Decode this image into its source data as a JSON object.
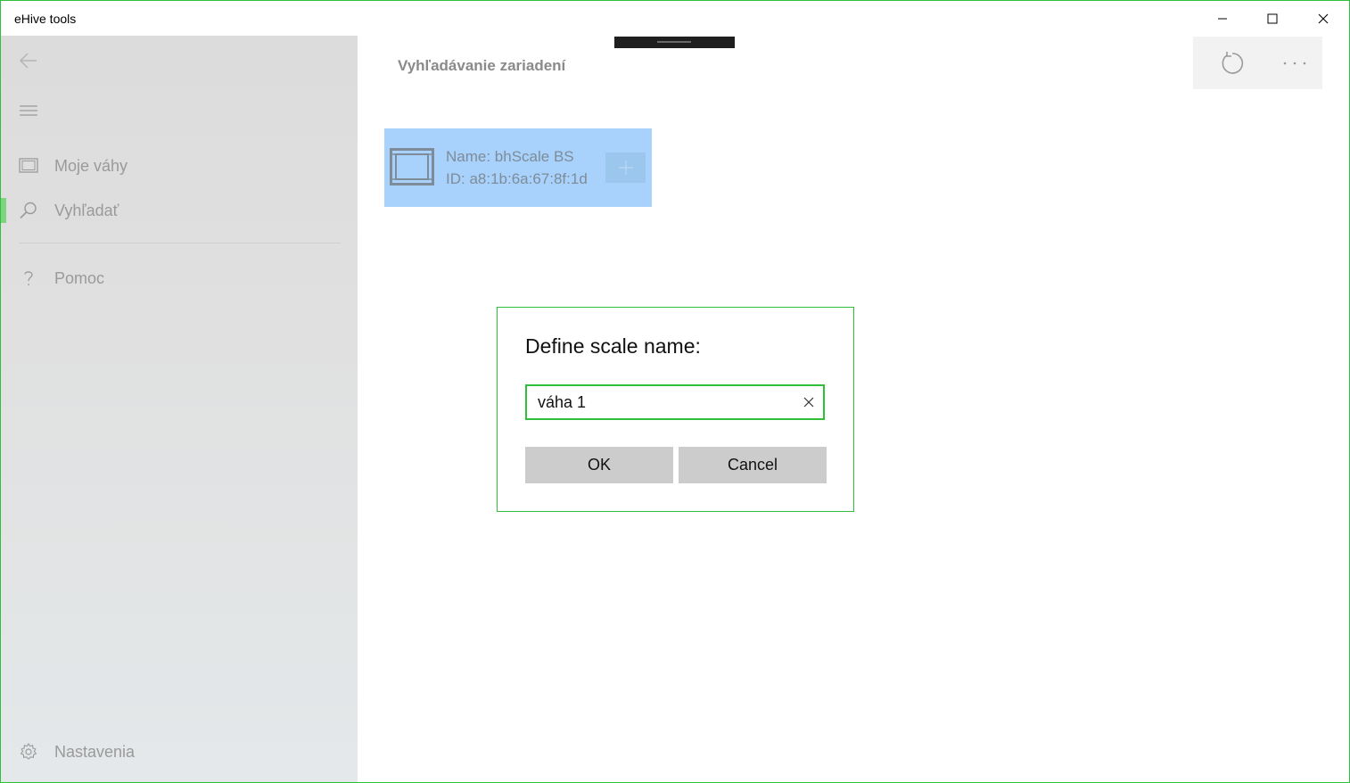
{
  "window": {
    "title": "eHive tools",
    "controls": [
      "minimize-icon",
      "maximize-icon",
      "close-icon"
    ]
  },
  "sidebar": {
    "items": [
      {
        "label": "Moje váhy",
        "icon": "scale-list-icon"
      },
      {
        "label": "Vyhľadať",
        "icon": "search-icon",
        "active": true
      },
      {
        "label": "Pomoc",
        "icon": "help-icon"
      },
      {
        "label": "Nastavenia",
        "icon": "settings-gear-icon"
      }
    ]
  },
  "page": {
    "title": "Vyhľadávanie zariadení"
  },
  "device_card": {
    "name": "Name: bhScale BS",
    "id": "ID: a8:1b:6a:67:8f:1d"
  },
  "dialog": {
    "title": "Define scale name:",
    "input_value": "váha 1",
    "ok_label": "OK",
    "cancel_label": "Cancel"
  },
  "colors": {
    "accent": "#2fbf3a",
    "active_nav": "#7ed37f",
    "device_card": "#a8d2fb"
  }
}
